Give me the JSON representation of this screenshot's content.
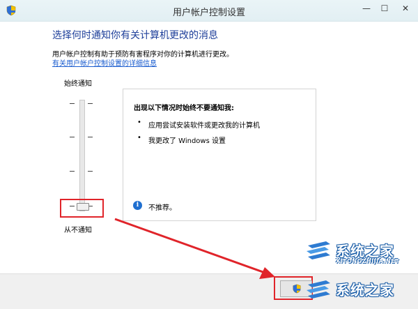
{
  "window": {
    "title": "用户帐户控制设置",
    "minimize": "—",
    "maximize": "☐",
    "close": "✕"
  },
  "main": {
    "heading": "选择何时通知你有关计算机更改的消息",
    "description": "用户帐户控制有助于预防有害程序对你的计算机进行更改。",
    "help_link": "有关用户帐户控制设置的详细信息"
  },
  "slider": {
    "top_label": "始终通知",
    "bottom_label": "从不通知",
    "level": 0,
    "levels": 4
  },
  "panel": {
    "title": "出现以下情况时始终不要通知我:",
    "bullets": [
      "应用尝试安装软件或更改我的计算机",
      "我更改了 Windows 设置"
    ],
    "bullet_glyph": "•",
    "info_glyph": "i",
    "note": "不推荐。"
  },
  "watermark": {
    "text": "系统之家",
    "sub": "XITONGZHIJIA.NET"
  },
  "colors": {
    "highlight": "#e0242a",
    "heading": "#1e3f9a",
    "link": "#1a5ccf"
  }
}
